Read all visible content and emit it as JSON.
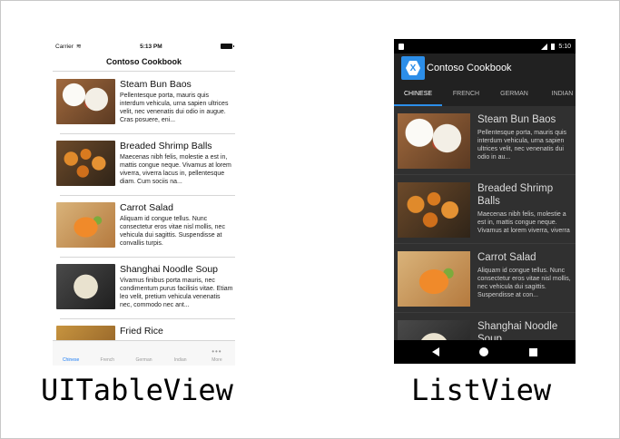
{
  "ios": {
    "status": {
      "carrier": "Carrier",
      "time": "5:13 PM"
    },
    "title": "Contoso Cookbook",
    "items": [
      {
        "name": "Steam Bun Baos",
        "desc": "Pellentesque porta, mauris quis interdum vehicula, urna sapien ultrices velit, nec venenatis dui odio in augue. Cras posuere, eni...",
        "image": "bun"
      },
      {
        "name": "Breaded Shrimp Balls",
        "desc": "Maecenas nibh felis, molestie a est in, mattis congue neque. Vivamus at lorem viverra, viverra lacus in, pellentesque diam. Cum sociis na...",
        "image": "shrimp"
      },
      {
        "name": "Carrot Salad",
        "desc": "Aliquam id congue tellus. Nunc consectetur eros vitae nisl mollis, nec vehicula dui sagittis. Suspendisse at convallis turpis.",
        "image": "carrot"
      },
      {
        "name": "Shanghai Noodle Soup",
        "desc": "Vivamus finibus porta mauris, nec condimentum purus facilisis vitae. Etiam leo velit, pretium vehicula venenatis nec, commodo nec ant...",
        "image": "noodle"
      },
      {
        "name": "Fried Rice",
        "desc": "",
        "image": "rice"
      }
    ],
    "tabs": [
      {
        "label": "Chinese",
        "active": true
      },
      {
        "label": "French",
        "active": false
      },
      {
        "label": "German",
        "active": false
      },
      {
        "label": "Indian",
        "active": false
      },
      {
        "label": "More",
        "active": false
      }
    ]
  },
  "android": {
    "status": {
      "time": "5:10"
    },
    "title": "Contoso Cookbook",
    "tabs": [
      {
        "label": "CHINESE",
        "active": true
      },
      {
        "label": "FRENCH",
        "active": false
      },
      {
        "label": "GERMAN",
        "active": false
      },
      {
        "label": "INDIAN",
        "active": false
      }
    ],
    "items": [
      {
        "name": "Steam Bun Baos",
        "desc": "Pellentesque porta, mauris quis interdum vehicula, urna sapien ultrices velit, nec venenatis dui odio in au...",
        "image": "bun"
      },
      {
        "name": "Breaded Shrimp Balls",
        "desc": "Maecenas nibh felis, molestie a est in, mattis congue neque. Vivamus at lorem viverra, viverra lacus in, pellentesque diam...",
        "image": "shrimp"
      },
      {
        "name": "Carrot Salad",
        "desc": "Aliquam id congue tellus. Nunc consectetur eros vitae nisl mollis, nec vehicula dui sagittis. Suspendisse at con...",
        "image": "carrot"
      },
      {
        "name": "Shanghai Noodle Soup",
        "desc": "",
        "image": "noodle"
      }
    ]
  },
  "captions": {
    "left": "UITableView",
    "right": "ListView"
  },
  "colors": {
    "ios_accent": "#1a7cf5",
    "android_accent": "#2c8ee9",
    "android_bg": "#303030"
  }
}
